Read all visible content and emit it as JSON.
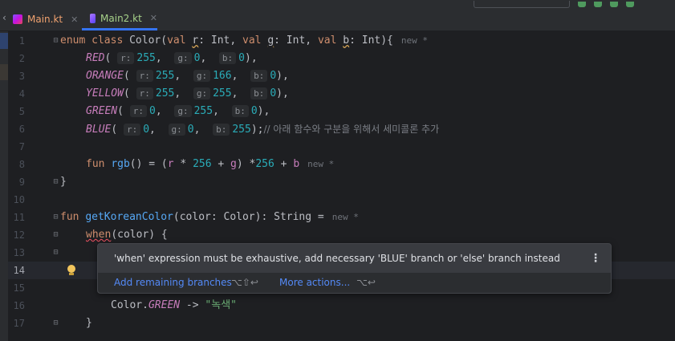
{
  "colors": {
    "bg": "#1e1f22",
    "keyword": "#cf8e6d",
    "enum_constant": "#c77dbb",
    "function": "#56a8f5",
    "number": "#2aacb8",
    "string": "#6aab73",
    "comment": "#7a7e85",
    "link": "#548af7",
    "run_green": "#57965c"
  },
  "tabs": [
    {
      "label": "Main.kt",
      "icon": "kotlin-file-icon",
      "close": "✕"
    },
    {
      "label": "Main2.kt",
      "icon": "kotlin-file-icon",
      "close": "✕"
    }
  ],
  "toolbar": {
    "chevron": "‹"
  },
  "editor": {
    "line_numbers": [
      "1",
      "2",
      "3",
      "4",
      "5",
      "6",
      "7",
      "8",
      "9",
      "10",
      "11",
      "12",
      "13",
      "14",
      "15",
      "16",
      "17"
    ],
    "line1": {
      "t1": "enum",
      "t2": "class",
      "t3": "Color(",
      "t4": "val",
      "t5": "r",
      "t6": ": Int, ",
      "t7": "val",
      "t8": "g",
      "t9": ": Int, ",
      "t10": "val",
      "t11": "b",
      "t12": ": Int){",
      "hint": "new *"
    },
    "line2": {
      "name": "RED",
      "h1": "r:",
      "v1": "255",
      "h2": "g:",
      "v2": "0",
      "h3": "b:",
      "v3": "0"
    },
    "line3": {
      "name": "ORANGE",
      "h1": "r:",
      "v1": "255",
      "h2": "g:",
      "v2": "166",
      "h3": "b:",
      "v3": "0"
    },
    "line4": {
      "name": "YELLOW",
      "h1": "r:",
      "v1": "255",
      "h2": "g:",
      "v2": "255",
      "h3": "b:",
      "v3": "0"
    },
    "line5": {
      "name": "GREEN",
      "h1": "r:",
      "v1": "0",
      "h2": "g:",
      "v2": "255",
      "h3": "b:",
      "v3": "0"
    },
    "line6": {
      "name": "BLUE",
      "h1": "r:",
      "v1": "0",
      "h2": "g:",
      "v2": "0",
      "h3": "b:",
      "v3": "255",
      "comment": "// 아래 함수와 구분을 위해서 세미콜론 추가"
    },
    "line8": {
      "kw": "fun",
      "fn": "rgb",
      "t1": "() = (",
      "r": "r",
      "t2": " * ",
      "n1": "256",
      "t3": " + ",
      "g": "g",
      "t4": ") *",
      "n2": "256",
      "t5": " + ",
      "b": "b",
      "hint": "new *"
    },
    "line9": {
      "text": "}"
    },
    "line11": {
      "kw": "fun",
      "fn": "getKoreanColor",
      "t1": "(color: Color): String =",
      "hint": "new *"
    },
    "line12": {
      "kw": "when",
      "t1": "(color) {"
    },
    "line16": {
      "t1": "Color.",
      "name": "GREEN",
      "t2": " -> ",
      "str": "\"녹색\""
    },
    "line17": {
      "text": "}"
    }
  },
  "popup": {
    "message": "'when' expression must be exhaustive, add necessary 'BLUE' branch or 'else' branch instead",
    "more_icon": "⋮",
    "action1": "Add remaining branches",
    "shortcut1": "⌥⇧↩",
    "action2": "More actions...",
    "shortcut2": "⌥↩"
  }
}
